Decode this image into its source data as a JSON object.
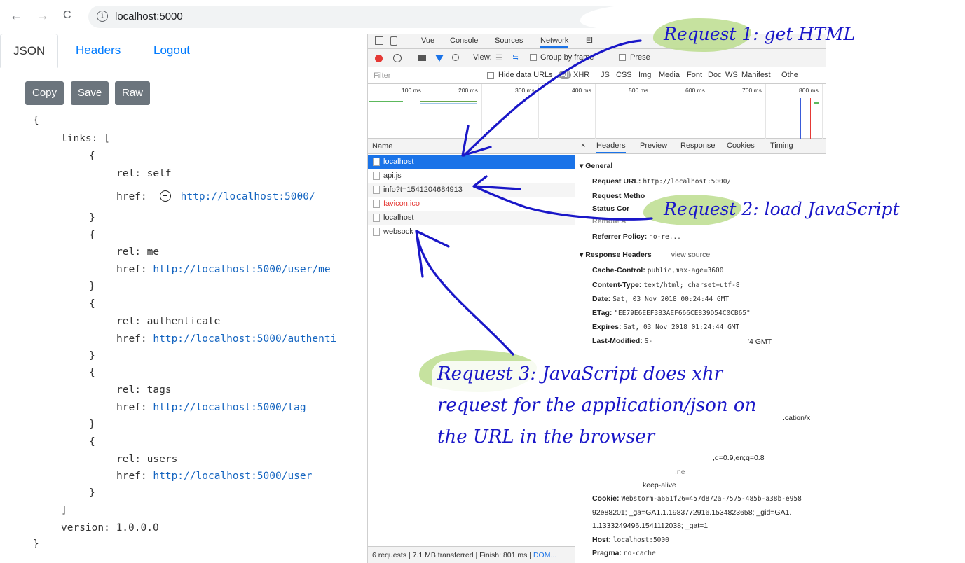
{
  "browser": {
    "back_icon": "←",
    "forward_icon": "→",
    "reload_icon": "C",
    "info_icon": "i",
    "url": "localhost:5000"
  },
  "app": {
    "tabs": [
      "JSON",
      "Headers",
      "Logout"
    ],
    "buttons": [
      "Copy",
      "Save",
      "Raw"
    ],
    "json_lines": {
      "open": "{",
      "links_key": "links: [",
      "l1_open": "{",
      "l1_rel": "rel: self",
      "l1_href_key": "href:",
      "l1_href": "http://localhost:5000/",
      "l1_close": "}",
      "l2_open": "{",
      "l2_rel": "rel: me",
      "l2_href_key": "href:",
      "l2_href": "http://localhost:5000/user/me",
      "l2_close": "}",
      "l3_open": "{",
      "l3_rel": "rel: authenticate",
      "l3_href_key": "href:",
      "l3_href": "http://localhost:5000/authenti",
      "l3_close": "}",
      "l4_open": "{",
      "l4_rel": "rel: tags",
      "l4_href_key": "href:",
      "l4_href": "http://localhost:5000/tag",
      "l4_close": "}",
      "l5_open": "{",
      "l5_rel": "rel: users",
      "l5_href_key": "href:",
      "l5_href": "http://localhost:5000/user",
      "l5_close": "}",
      "links_close": "]",
      "version": "version: 1.0.0.0",
      "close": "}"
    }
  },
  "devtools": {
    "tabs": [
      "Vue",
      "Console",
      "Sources",
      "Network",
      "El"
    ],
    "toolbar": {
      "view_label": "View:",
      "group_label": "Group by frame",
      "preserve_label": "Prese"
    },
    "filter": {
      "placeholder": "Filter",
      "hide_data_urls": "Hide data URLs",
      "types": [
        "All",
        "XHR",
        "JS",
        "CSS",
        "Img",
        "Media",
        "Font",
        "Doc",
        "WS",
        "Manifest",
        "Othe"
      ]
    },
    "timeline_ticks": [
      "100 ms",
      "200 ms",
      "300 ms",
      "400 ms",
      "500 ms",
      "600 ms",
      "700 ms",
      "800 ms"
    ],
    "list_header": "Name",
    "requests": [
      "localhost",
      "api.js",
      "info?t=1541204684913",
      "favicon.ico",
      "localhost",
      "websock"
    ],
    "status_bar": {
      "text": "6 requests | 7.1 MB transferred | Finish: 801 ms | ",
      "dom": "DOM..."
    },
    "detail_tabs": [
      "×",
      "Headers",
      "Preview",
      "Response",
      "Cookies",
      "Timing"
    ],
    "general": {
      "title": "▾ General",
      "request_url_k": "Request URL:",
      "request_url_v": "http://localhost:5000/",
      "request_method_k": "Request Metho",
      "status_code_k": "Status Cor",
      "remote_k": "Remote A",
      "referrer_k": "Referrer Policy:",
      "referrer_v": "no-re..."
    },
    "response_headers": {
      "title": "▾ Response Headers",
      "view_source": "view source",
      "cache_k": "Cache-Control:",
      "cache_v": "public,max-age=3600",
      "ctype_k": "Content-Type:",
      "ctype_v": "text/html; charset=utf-8",
      "date_k": "Date:",
      "date_v": "Sat, 03 Nov 2018 00:24:44 GMT",
      "etag_k": "ETag:",
      "etag_v": "\"EE79E6EEF383AEF666CE839D54C0CB65\"",
      "expires_k": "Expires:",
      "expires_v": "Sat, 03 Nov 2018 01:24:44 GMT",
      "lastmod_k": "Last-Modified:",
      "lastmod_v": "S-",
      "lastmod_tail": "'4 GMT"
    },
    "request_headers_partial": {
      "accept_tail": ".cation/x",
      "lang_tail": ",q=0.9,en;q=0.8",
      "encoding_tail": ".ne",
      "connection_tail": "keep-alive",
      "cookie_k": "Cookie:",
      "cookie_v1": "Webstorm-a661f26=457d872a-7575-485b-a38b-e958",
      "cookie_v2": "92e88201; _ga=GA1.1.1983772916.1534823658; _gid=GA1.",
      "cookie_v3": "1.1333249496.1541112038; _gat=1",
      "host_k": "Host:",
      "host_v": "localhost:5000",
      "pragma_k": "Pragma:",
      "pragma_v": "no-cache"
    }
  },
  "annotations": {
    "note1": "Request  1: get HTML",
    "note2": "Request 2: load JavaScript",
    "note3_l1": "Request 3: JavaScript does xhr",
    "note3_l2": "request for the application/json on",
    "note3_l3": "the URL in the browser",
    "highlight_color": "#b9dc8a",
    "ink_color": "#1a17c8"
  }
}
